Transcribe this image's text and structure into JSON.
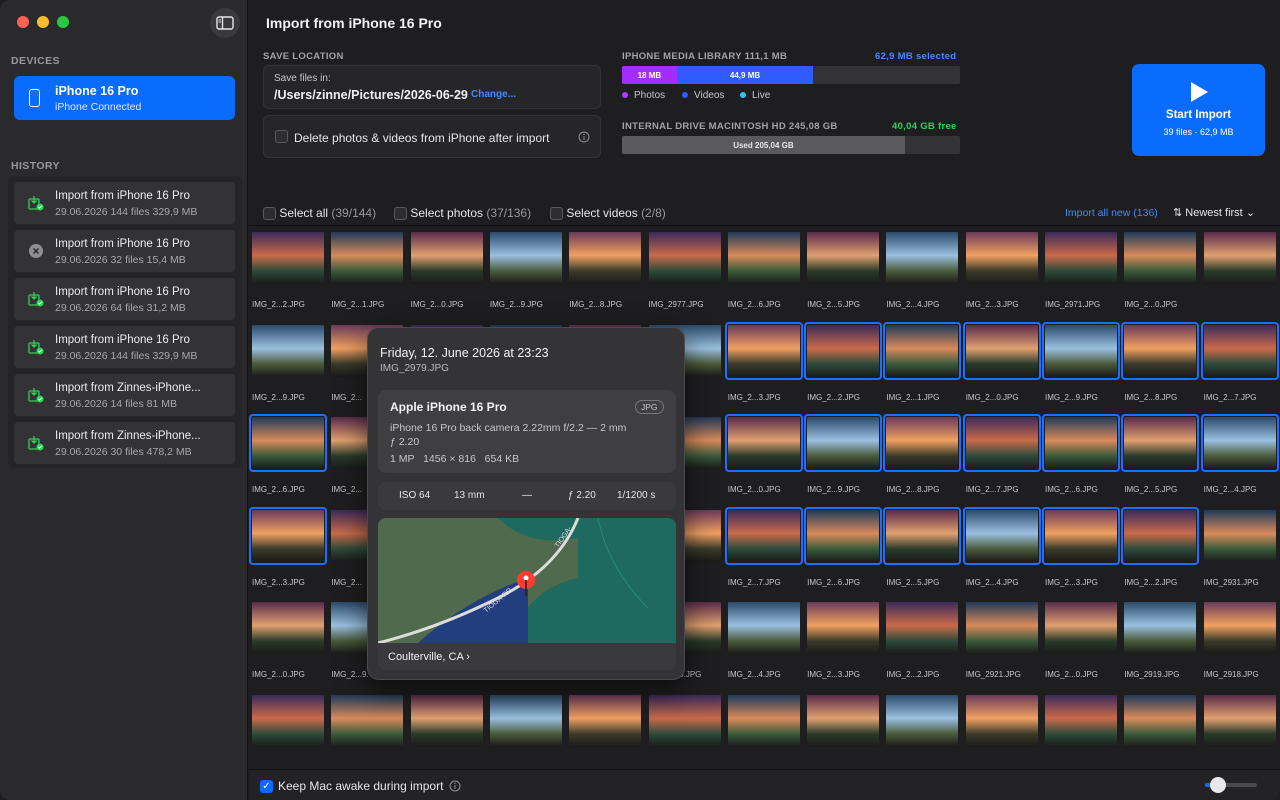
{
  "sidebar": {
    "devices_heading": "DEVICES",
    "device": {
      "name": "iPhone 16 Pro",
      "status": "iPhone  Connected"
    },
    "history_heading": "HISTORY",
    "history": [
      {
        "title": "Import from iPhone 16 Pro",
        "meta": "29.06.2026  144 files  329,9 MB",
        "status": "success"
      },
      {
        "title": "Import from iPhone 16 Pro",
        "meta": "29.06.2026  32 files  15,4 MB",
        "status": "cancelled"
      },
      {
        "title": "Import from iPhone 16 Pro",
        "meta": "29.06.2026  64 files  31,2 MB",
        "status": "success"
      },
      {
        "title": "Import from iPhone 16 Pro",
        "meta": "29.06.2026  144 files  329,9 MB",
        "status": "success"
      },
      {
        "title": "Import from Zinnes-iPhone...",
        "meta": "29.06.2026  14 files  81 MB",
        "status": "success"
      },
      {
        "title": "Import from Zinnes-iPhone...",
        "meta": "29.06.2026  30 files  478,2 MB",
        "status": "success"
      }
    ]
  },
  "header": {
    "title": "Import from iPhone 16 Pro"
  },
  "save": {
    "heading": "SAVE LOCATION",
    "files_in_label": "Save files in:",
    "path": "/Users/zinne/Pictures/2026-06-29",
    "change": "Change...",
    "delete_label": "Delete photos & videos from iPhone after import"
  },
  "library": {
    "heading": "IPHONE MEDIA LIBRARY 111,1 MB",
    "selected": "62,9 MB selected",
    "photos_seg": "18 MB",
    "videos_seg": "44,9 MB",
    "photos_fraction": 0.162,
    "videos_fraction": 0.404,
    "legend": [
      "Photos",
      "Videos",
      "Live"
    ],
    "colors": {
      "photos": "#b03cff",
      "videos": "#2f5bff",
      "live": "#27c6ff"
    }
  },
  "drive": {
    "heading": "INTERNAL DRIVE MACINTOSH HD 245,08 GB",
    "free": "40,04 GB free",
    "used": "Used 205,04 GB",
    "used_fraction": 0.837
  },
  "start": {
    "label": "Start Import",
    "meta": "39 files · 62,9 MB"
  },
  "toolbar": {
    "select_all": "Select all",
    "select_all_count": "(39/144)",
    "select_photos": "Select photos",
    "select_photos_count": "(37/136)",
    "select_videos": "Select videos",
    "select_videos_count": "(2/8)",
    "import_new": "Import all new (136)",
    "sort": "Newest first"
  },
  "grid": {
    "rows": [
      [
        "IMG_2...2.JPG",
        "IMG_2...1.JPG",
        "IMG_2...0.JPG",
        "IMG_2...9.JPG",
        "IMG_2...8.JPG",
        "IMG_2977.JPG",
        "IMG_2...6.JPG",
        "IMG_2...5.JPG",
        "IMG_2...4.JPG",
        "IMG_2...3.JPG",
        "IMG_2971.JPG",
        "IMG_2...0.JPG"
      ],
      [
        "IMG_2...9.JPG",
        "IMG_2...",
        "",
        "",
        "",
        "",
        "IMG_2...3.JPG",
        "IMG_2...2.JPG",
        "IMG_2...1.JPG",
        "IMG_2...0.JPG",
        "IMG_2...9.JPG",
        "IMG_2...8.JPG",
        "IMG_2...7.JPG"
      ],
      [
        "IMG_2...6.JPG",
        "IMG_2...",
        "",
        "",
        "",
        "",
        "IMG_2...0.JPG",
        "IMG_2...9.JPG",
        "IMG_2...8.JPG",
        "IMG_2...7.JPG",
        "IMG_2...6.JPG",
        "IMG_2...5.JPG",
        "IMG_2...4.JPG"
      ],
      [
        "IMG_2...3.JPG",
        "IMG_2...",
        "",
        "",
        "",
        "",
        "IMG_2...7.JPG",
        "IMG_2...6.JPG",
        "IMG_2...5.JPG",
        "IMG_2...4.JPG",
        "IMG_2...3.JPG",
        "IMG_2...2.JPG",
        "IMG_2931.JPG"
      ],
      [
        "IMG_2...0.JPG",
        "IMG_2...9.",
        "",
        "",
        "",
        "IMG_2...5.JPG",
        "IMG_2...4.JPG",
        "IMG_2...3.JPG",
        "IMG_2...2.JPG",
        "IMG_2921.JPG",
        "IMG_2...0.JPG",
        "IMG_2919.JPG",
        "IMG_2918.JPG"
      ],
      [
        "",
        "",
        "",
        "",
        "",
        "",
        "",
        "",
        "",
        "",
        "",
        "",
        ""
      ]
    ]
  },
  "popover": {
    "date": "Friday, 12. June 2026 at 23:23",
    "filename": "IMG_2979.JPG",
    "camera": "Apple iPhone 16 Pro",
    "format": "JPG",
    "lens": "iPhone 16 Pro back camera 2.22mm f/2.2 — 2 mm ƒ 2.20",
    "specs": "1 MP   1456 × 816   654 KB",
    "iso": "ISO 64",
    "focal": "13 mm",
    "ev": "—",
    "aperture": "ƒ 2.20",
    "shutter": "1/1200 s",
    "road1": "TIOGA-RD",
    "road2": "TIOGA-",
    "location": "Coulterville, CA"
  },
  "bottom": {
    "keep_awake": "Keep Mac awake during import"
  },
  "zoom_slider": 0.25
}
